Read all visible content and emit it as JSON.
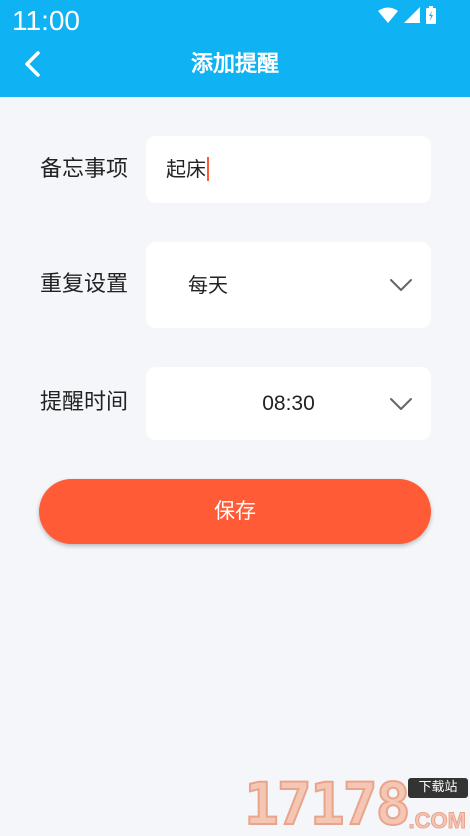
{
  "status_bar": {
    "time": "11:00"
  },
  "header": {
    "title": "添加提醒"
  },
  "form": {
    "memo": {
      "label": "备忘事项",
      "value": "起床"
    },
    "repeat": {
      "label": "重复设置",
      "value": "每天"
    },
    "time": {
      "label": "提醒时间",
      "value": "08:30"
    }
  },
  "save_button": {
    "label": "保存"
  },
  "watermark": {
    "digits": "17178",
    "badge": "下载站",
    "suffix": ".COM"
  },
  "colors": {
    "primary": "#0fb3f4",
    "accent": "#ff5b36",
    "background": "#f5f6fa"
  },
  "icons": {
    "back": "chevron-left-icon",
    "dropdown": "chevron-down-icon",
    "wifi": "wifi-icon",
    "signal": "signal-icon",
    "battery": "battery-icon"
  }
}
